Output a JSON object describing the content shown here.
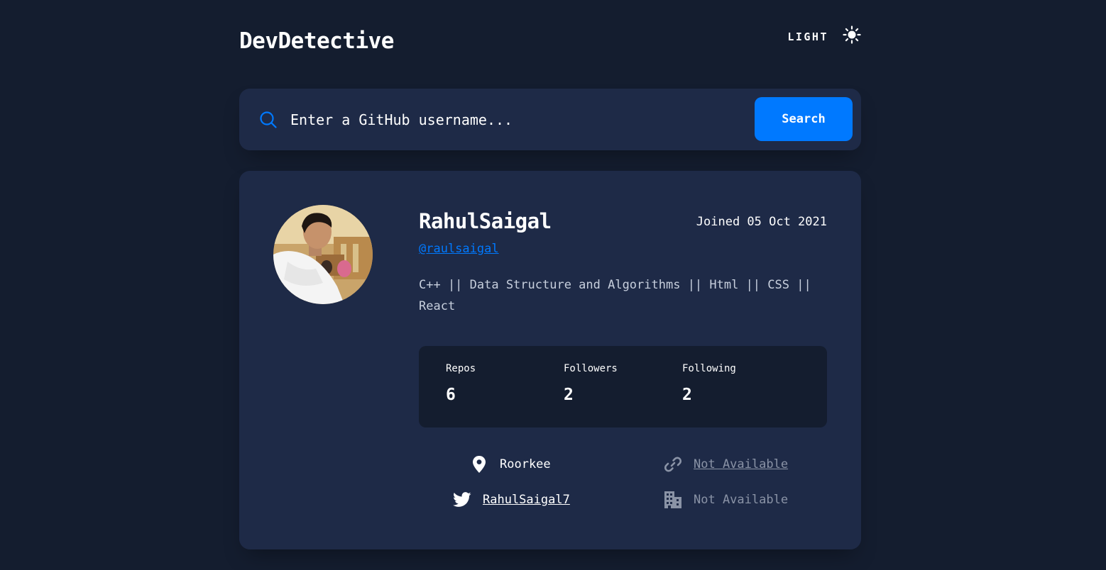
{
  "header": {
    "title": "DevDetective",
    "theme_label": "LIGHT",
    "theme_icon": "sun-icon"
  },
  "search": {
    "placeholder": "Enter a GitHub username...",
    "button_label": "Search",
    "icon": "search-icon"
  },
  "profile": {
    "name": "RahulSaigal",
    "joined": "Joined 05 Oct 2021",
    "login": "@raulsaigal",
    "bio": "C++ || Data Structure and Algorithms || Html || CSS || React",
    "stats": [
      {
        "label": "Repos",
        "value": "6"
      },
      {
        "label": "Followers",
        "value": "2"
      },
      {
        "label": "Following",
        "value": "2"
      }
    ],
    "links": {
      "location": {
        "icon": "location-pin-icon",
        "text": "Roorkee"
      },
      "website": {
        "icon": "link-icon",
        "text": "Not Available"
      },
      "twitter": {
        "icon": "twitter-icon",
        "text": "RahulSaigal7"
      },
      "company": {
        "icon": "building-icon",
        "text": "Not Available"
      }
    }
  },
  "colors": {
    "background": "#141d2f",
    "card": "#1e2a47",
    "accent": "#0079ff",
    "muted": "#8a93a6"
  }
}
